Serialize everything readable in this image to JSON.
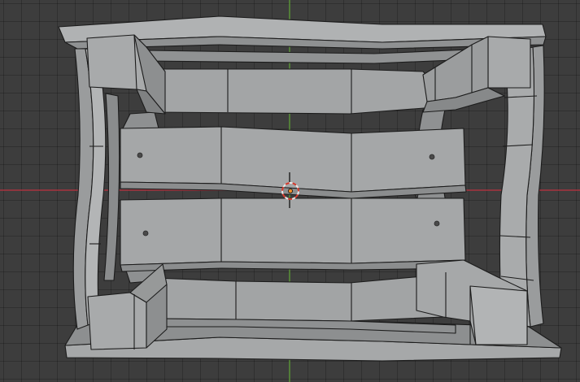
{
  "viewport": {
    "mode": "3D Viewport",
    "shading": "solid",
    "grid": true,
    "colors": {
      "background": "#3d3d3d",
      "x_axis": "#a8333e",
      "y_axis": "#5e9a3a",
      "mesh_face": "#a4a6a7",
      "mesh_face_shadow": "#8d8f90",
      "mesh_edge": "#1c1c1c",
      "cursor_ring_a": "#e8e8e8",
      "cursor_ring_b": "#d43b2e",
      "origin": "#f08d2a"
    },
    "objects": [
      {
        "name": "outer-frame",
        "icon": "mesh-icon"
      },
      {
        "name": "inner-rails",
        "icon": "mesh-icon"
      },
      {
        "name": "corner-blocks",
        "icon": "mesh-icon"
      },
      {
        "name": "center-boards",
        "icon": "mesh-icon"
      },
      {
        "name": "screw-heads",
        "icon": "screw-icon"
      }
    ],
    "cursor": {
      "icon": "3d-cursor-icon"
    },
    "origin": {
      "icon": "origin-dot-icon"
    }
  }
}
